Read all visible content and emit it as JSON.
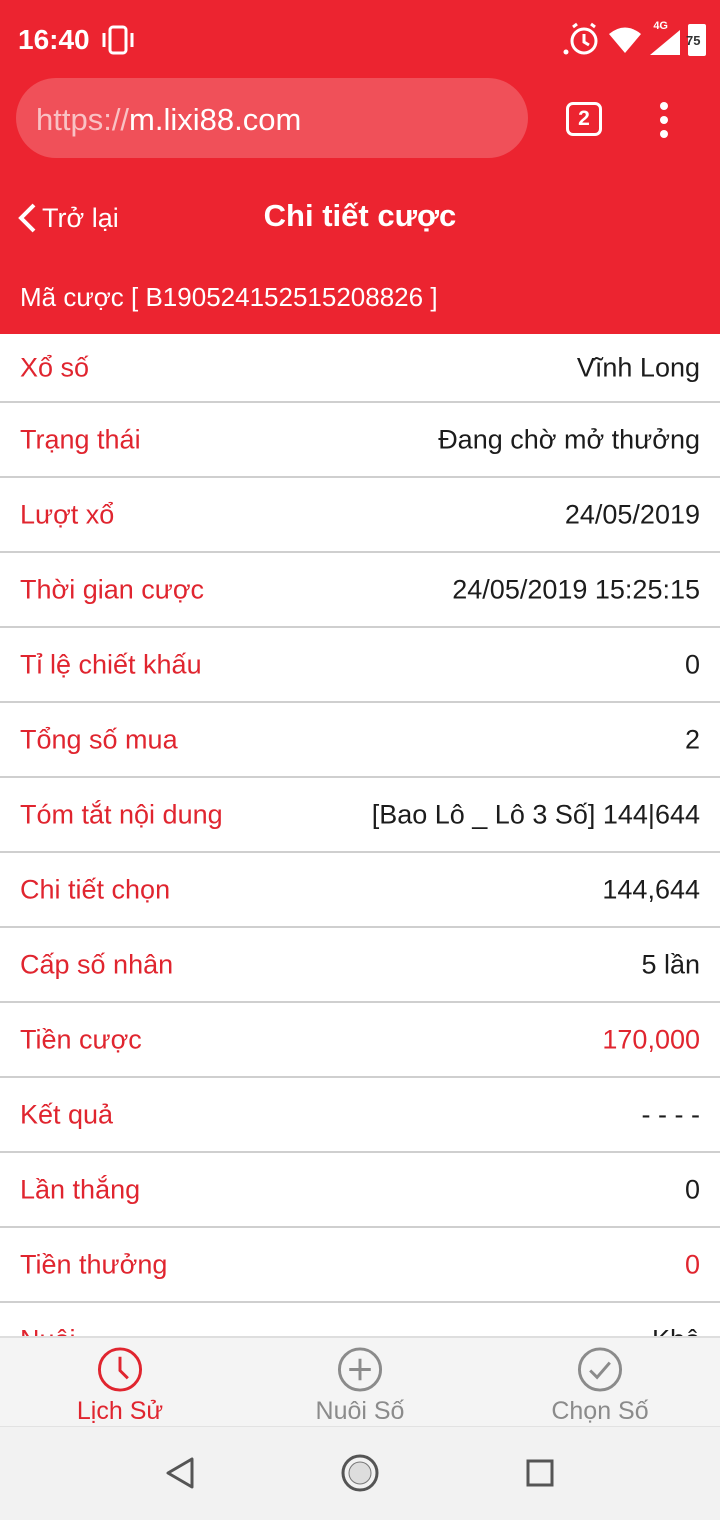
{
  "status_bar": {
    "time": "16:40",
    "network": "4G",
    "battery": "75",
    "icons": [
      "vibrate-icon",
      "alarm-icon",
      "wifi-icon",
      "signal-icon",
      "battery-icon"
    ]
  },
  "browser": {
    "url_scheme": "https://",
    "url_host": "m.lixi88.com",
    "tab_count": "2"
  },
  "header": {
    "back_label": "Trở lại",
    "title": "Chi tiết cược",
    "bet_code": "Mã cược [ B190524152515208826 ]"
  },
  "details": [
    {
      "label": "Xổ số",
      "value": "Vĩnh Long"
    },
    {
      "label": "Trạng thái",
      "value": "Đang chờ mở thưởng"
    },
    {
      "label": "Lượt xổ",
      "value": "24/05/2019"
    },
    {
      "label": "Thời gian cược",
      "value": "24/05/2019 15:25:15"
    },
    {
      "label": "Tỉ lệ chiết khấu",
      "value": "0"
    },
    {
      "label": "Tổng số mua",
      "value": "2"
    },
    {
      "label": "Tóm tắt nội dung",
      "value": "[Bao Lô _ Lô 3 Số] 144|644"
    },
    {
      "label": "Chi tiết chọn",
      "value": "144,644"
    },
    {
      "label": "Cấp số nhân",
      "value": "5 lần"
    },
    {
      "label": "Tiền cược",
      "value": "170,000"
    },
    {
      "label": "Kết quả",
      "value": "- - - -"
    },
    {
      "label": "Lần thắng",
      "value": "0"
    },
    {
      "label": "Tiền thưởng",
      "value": "0"
    },
    {
      "label": "Nuôi",
      "value": "Khô"
    }
  ],
  "tabs": [
    {
      "label": "Lịch Sử",
      "icon": "clock-icon",
      "active": true
    },
    {
      "label": "Nuôi Số",
      "icon": "plus-circle-icon",
      "active": false
    },
    {
      "label": "Chọn Số",
      "icon": "check-circle-icon",
      "active": false
    }
  ],
  "nav": [
    "back-triangle-icon",
    "home-circle-icon",
    "recents-square-icon"
  ],
  "colors": {
    "brand_red": "#ec2430",
    "label_red": "#e0252f",
    "value_text": "#1c1c1c",
    "tab_inactive": "#8b8b8b"
  }
}
